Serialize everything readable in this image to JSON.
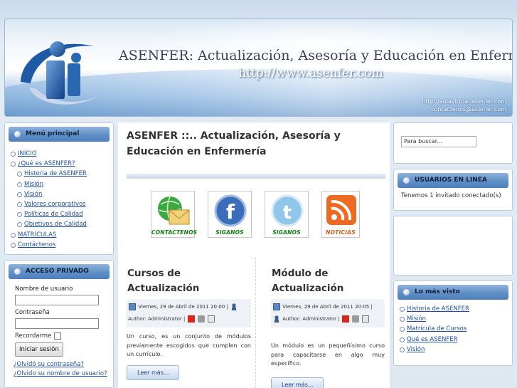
{
  "header": {
    "title": "ASENFER: Actualización, Asesoría y Educación  en Enfermería",
    "url": "http://www.asenfer.com",
    "contact_line1": "http://aulavirtual.asenfer.com",
    "contact_line2": "contactenos@asenfer.com"
  },
  "main_menu": {
    "title": "Menú principal",
    "items": [
      {
        "label": "INICIO",
        "sub": false
      },
      {
        "label": "¿Qué es ASENFER?",
        "sub": false
      },
      {
        "label": "Historia de ASENFER",
        "sub": true
      },
      {
        "label": "Misión",
        "sub": true
      },
      {
        "label": "Visión",
        "sub": true
      },
      {
        "label": "Valores corporativos",
        "sub": true
      },
      {
        "label": "Políticas de Calidad",
        "sub": true
      },
      {
        "label": "Objetivos de Calidad",
        "sub": true
      },
      {
        "label": "MATRÍCULAS",
        "sub": false
      },
      {
        "label": "Contáctenos",
        "sub": false
      }
    ]
  },
  "login": {
    "title": "ACCESO PRIVADO",
    "username_label": "Nombre de usuario",
    "password_label": "Contraseña",
    "remember_label": "Recordarme",
    "submit_label": "Iniciar sesión",
    "forgot_password": "¿Olvidó su contraseña?",
    "forgot_username": "¿Olvido su nombre de usuario?"
  },
  "main": {
    "title_prefix": "ASENFER ::.. ",
    "title_rest": "Actualización, Asesoría y Educación en Enfermería",
    "social": [
      {
        "caption": "CONTACTENOS",
        "icon": "contact-globe-mail-icon"
      },
      {
        "caption": "SIGANOS",
        "icon": "facebook-icon"
      },
      {
        "caption": "SIGANOS",
        "icon": "twitter-icon"
      },
      {
        "caption": "NOTICIAS",
        "icon": "rss-feed-icon"
      }
    ],
    "articles": [
      {
        "title": "Cursos de Actualización",
        "date": "Viernes, 29 de Abril de 2011 20:00",
        "author": "Author: Administrator",
        "intro": "Un curso, es un conjunto de módulos previamente escogidos que cumplen con un currículo.",
        "more": "Leer más..."
      },
      {
        "title": "Módulo de Actualización",
        "date": "Viernes, 29 de Abril de 2011 20:05",
        "author": "Author: Administrator",
        "intro": "Un módulo es un pequeñísimo curso para capacitarse en algo muy específico.",
        "more": "Leer más..."
      }
    ]
  },
  "right": {
    "search_placeholder": "Para buscar...",
    "online_title": "USUARIOS EN LINEA",
    "online_text": "Tenemos 1 invitado conectado(s)",
    "popular_title": "Lo más visto",
    "popular_items": [
      "Historia de ASENFER",
      "Misión",
      "Matrícula de Cursos",
      "Qué es ASENFER",
      "Visión"
    ]
  },
  "colors": {
    "accent": "#4d7fbc",
    "link": "#1f4fa0"
  }
}
